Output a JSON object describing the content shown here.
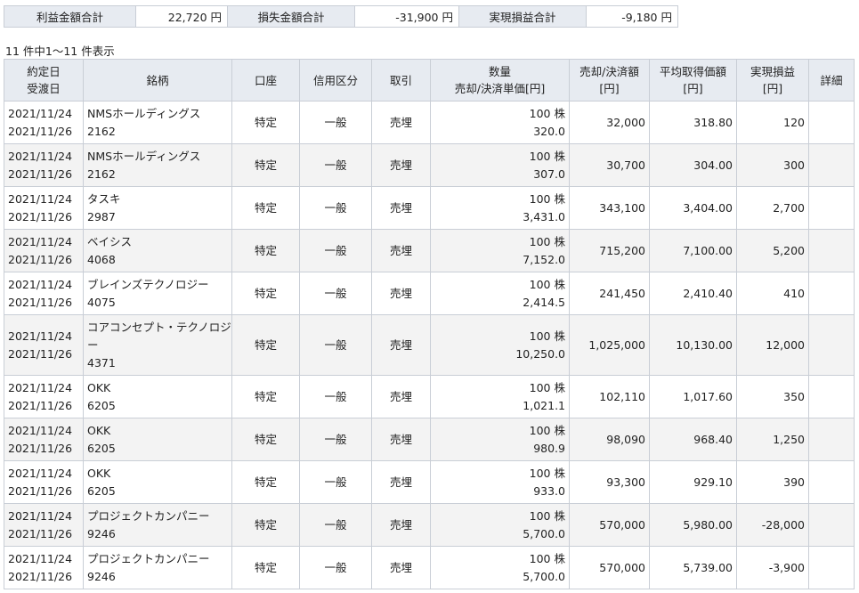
{
  "summary": {
    "profit_label": "利益金額合計",
    "profit_value": "22,720 円",
    "loss_label": "損失金額合計",
    "loss_value": "-31,900 円",
    "realized_label": "実現損益合計",
    "realized_value": "-9,180 円"
  },
  "count_text": "11 件中1～11 件表示",
  "headers": {
    "contract_date": "約定日",
    "delivery_date": "受渡日",
    "stock": "銘柄",
    "account": "口座",
    "credit_type": "信用区分",
    "trade": "取引",
    "qty": "数量",
    "unit_price": "売却/決済単価[円]",
    "amount1": "売却/決済額",
    "amount2": "[円]",
    "avg1": "平均取得価額",
    "avg2": "[円]",
    "pl1": "実現損益",
    "pl2": "[円]",
    "detail": "詳細"
  },
  "rows": [
    {
      "contract": "2021/11/24",
      "delivery": "2021/11/26",
      "name": "NMSホールディングス",
      "code": "2162",
      "account": "特定",
      "credit": "一般",
      "trade": "売埋",
      "qty": "100 株",
      "price": "320.0",
      "amount": "32,000",
      "avg": "318.80",
      "pl": "120"
    },
    {
      "contract": "2021/11/24",
      "delivery": "2021/11/26",
      "name": "NMSホールディングス",
      "code": "2162",
      "account": "特定",
      "credit": "一般",
      "trade": "売埋",
      "qty": "100 株",
      "price": "307.0",
      "amount": "30,700",
      "avg": "304.00",
      "pl": "300"
    },
    {
      "contract": "2021/11/24",
      "delivery": "2021/11/26",
      "name": "タスキ",
      "code": "2987",
      "account": "特定",
      "credit": "一般",
      "trade": "売埋",
      "qty": "100 株",
      "price": "3,431.0",
      "amount": "343,100",
      "avg": "3,404.00",
      "pl": "2,700"
    },
    {
      "contract": "2021/11/24",
      "delivery": "2021/11/26",
      "name": "ベイシス",
      "code": "4068",
      "account": "特定",
      "credit": "一般",
      "trade": "売埋",
      "qty": "100 株",
      "price": "7,152.0",
      "amount": "715,200",
      "avg": "7,100.00",
      "pl": "5,200"
    },
    {
      "contract": "2021/11/24",
      "delivery": "2021/11/26",
      "name": "ブレインズテクノロジー",
      "code": "4075",
      "account": "特定",
      "credit": "一般",
      "trade": "売埋",
      "qty": "100 株",
      "price": "2,414.5",
      "amount": "241,450",
      "avg": "2,410.40",
      "pl": "410"
    },
    {
      "contract": "2021/11/24",
      "delivery": "2021/11/26",
      "name": "コアコンセプト・テクノロジ",
      "name2": "ー",
      "code": "4371",
      "account": "特定",
      "credit": "一般",
      "trade": "売埋",
      "qty": "100 株",
      "price": "10,250.0",
      "amount": "1,025,000",
      "avg": "10,130.00",
      "pl": "12,000"
    },
    {
      "contract": "2021/11/24",
      "delivery": "2021/11/26",
      "name": "OKK",
      "code": "6205",
      "account": "特定",
      "credit": "一般",
      "trade": "売埋",
      "qty": "100 株",
      "price": "1,021.1",
      "amount": "102,110",
      "avg": "1,017.60",
      "pl": "350"
    },
    {
      "contract": "2021/11/24",
      "delivery": "2021/11/26",
      "name": "OKK",
      "code": "6205",
      "account": "特定",
      "credit": "一般",
      "trade": "売埋",
      "qty": "100 株",
      "price": "980.9",
      "amount": "98,090",
      "avg": "968.40",
      "pl": "1,250"
    },
    {
      "contract": "2021/11/24",
      "delivery": "2021/11/26",
      "name": "OKK",
      "code": "6205",
      "account": "特定",
      "credit": "一般",
      "trade": "売埋",
      "qty": "100 株",
      "price": "933.0",
      "amount": "93,300",
      "avg": "929.10",
      "pl": "390"
    },
    {
      "contract": "2021/11/24",
      "delivery": "2021/11/26",
      "name": "プロジェクトカンパニー",
      "code": "9246",
      "account": "特定",
      "credit": "一般",
      "trade": "売埋",
      "qty": "100 株",
      "price": "5,700.0",
      "amount": "570,000",
      "avg": "5,980.00",
      "pl": "-28,000"
    },
    {
      "contract": "2021/11/24",
      "delivery": "2021/11/26",
      "name": "プロジェクトカンパニー",
      "code": "9246",
      "account": "特定",
      "credit": "一般",
      "trade": "売埋",
      "qty": "100 株",
      "price": "5,700.0",
      "amount": "570,000",
      "avg": "5,739.00",
      "pl": "-3,900"
    }
  ]
}
